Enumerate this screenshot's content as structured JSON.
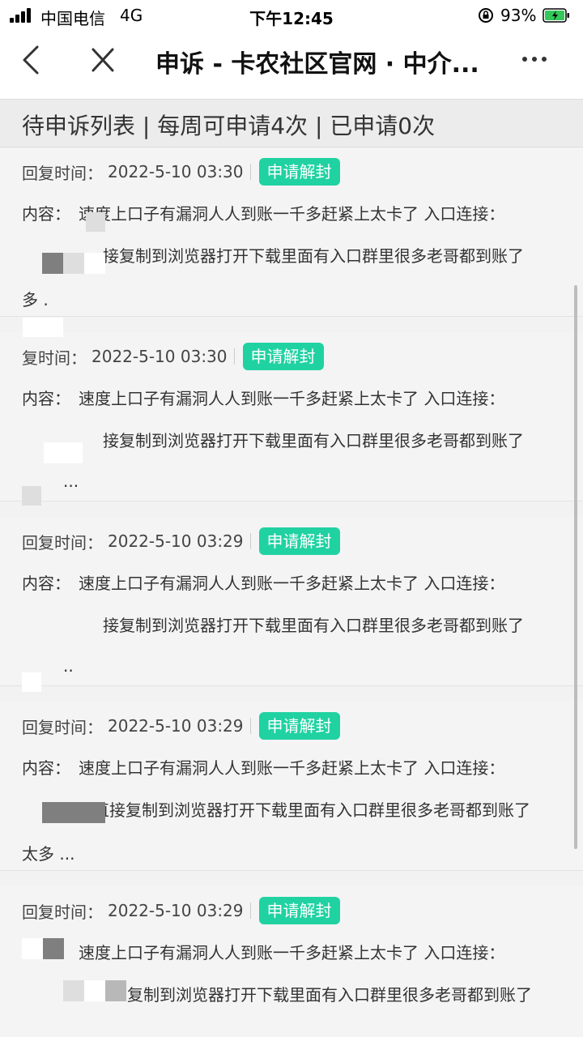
{
  "status_bar": {
    "carrier": "中国电信",
    "network": "4G",
    "time": "下午12:45",
    "battery_percent": "93%"
  },
  "nav": {
    "title": "申诉 - 卡农社区官网 · 中介..."
  },
  "summary": {
    "text": "待申诉列表 | 每周可申请4次 | 已申请0次"
  },
  "items": [
    {
      "time_label": "回复时间：",
      "time": "2022-5-10 03:30",
      "button_label": "申请解封",
      "content_label": "内容：",
      "content_line1": "速度上口子有漏洞人人到账一千多赶紧上太卡了 入口连接：",
      "content_line2": "接复制到浏览器打开下载里面有入口群里很多老哥都到账了",
      "content_line3": "多 ."
    },
    {
      "time_label": "复时间：",
      "time": "2022-5-10 03:30",
      "button_label": "申请解封",
      "content_label": "内容：",
      "content_line1": "速度上口子有漏洞人人到账一千多赶紧上太卡了 入口连接：",
      "content_line2": "接复制到浏览器打开下载里面有入口群里很多老哥都到账了",
      "content_line3": "..."
    },
    {
      "time_label": "回复时间：",
      "time": "2022-5-10 03:29",
      "button_label": "申请解封",
      "content_label": "内容：",
      "content_line1": "速度上口子有漏洞人人到账一千多赶紧上太卡了 入口连接：",
      "content_line2": "接复制到浏览器打开下载里面有入口群里很多老哥都到账了",
      "content_line3": ".."
    },
    {
      "time_label": "回复时间：",
      "time": "2022-5-10 03:29",
      "button_label": "申请解封",
      "content_label": "内容：",
      "content_line1": "速度上口子有漏洞人人到账一千多赶紧上太卡了 入口连接：",
      "content_line2": "直接复制到浏览器打开下载里面有入口群里很多老哥都到账了",
      "content_line3": "太多 ..."
    },
    {
      "time_label": "回复时间：",
      "time": "2022-5-10 03:29",
      "button_label": "申请解封",
      "content_label": "",
      "content_line1": "速度上口子有漏洞人人到账一千多赶紧上太卡了 入口连接：",
      "content_line2": "复制到浏览器打开下载里面有入口群里很多老哥都到账了",
      "content_line3": ""
    }
  ],
  "colors": {
    "accent": "#20d2a2",
    "background": "#f2f2f2"
  }
}
